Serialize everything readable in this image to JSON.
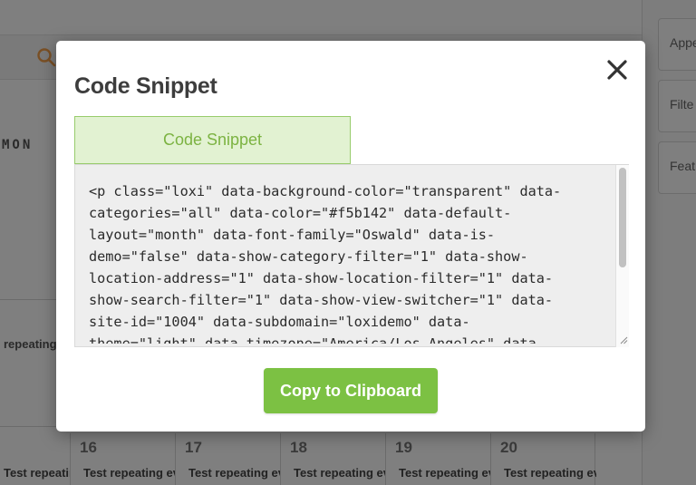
{
  "background": {
    "weekday_label": "MON",
    "left_event_label": "repeating",
    "row_event_label": "Test repeating ev",
    "days": [
      {
        "num": "16",
        "event": "Test repeating ev"
      },
      {
        "num": "17",
        "event": "Test repeating ev"
      },
      {
        "num": "18",
        "event": "Test repeating ev"
      },
      {
        "num": "19",
        "event": "Test repeating ev"
      },
      {
        "num": "20",
        "event": "Test repeating ev"
      }
    ],
    "sidebar_cards": [
      "Appe",
      "Filte",
      "Feat"
    ]
  },
  "modal": {
    "title": "Code Snippet",
    "tab_label": "Code Snippet",
    "code": "<p class=\"loxi\" data-background-color=\"transparent\" data-\ncategories=\"all\" data-color=\"#f5b142\" data-default-\nlayout=\"month\" data-font-family=\"Oswald\" data-is-\ndemo=\"false\" data-show-category-filter=\"1\" data-show-\nlocation-address=\"1\" data-show-location-filter=\"1\" data-\nshow-search-filter=\"1\" data-show-view-switcher=\"1\" data-\nsite-id=\"1004\" data-subdomain=\"loxidemo\" data-\ntheme=\"light\" data-timezone=\"America/Los_Angeles\" data-",
    "copy_button_label": "Copy to Clipboard"
  },
  "icons": {
    "close": "close-icon",
    "search": "search-icon"
  },
  "colors": {
    "accent_green": "#7cc143",
    "tab_bg": "#e2f2d2",
    "tab_text": "#7cb342",
    "search_orange": "#f5a04a"
  }
}
